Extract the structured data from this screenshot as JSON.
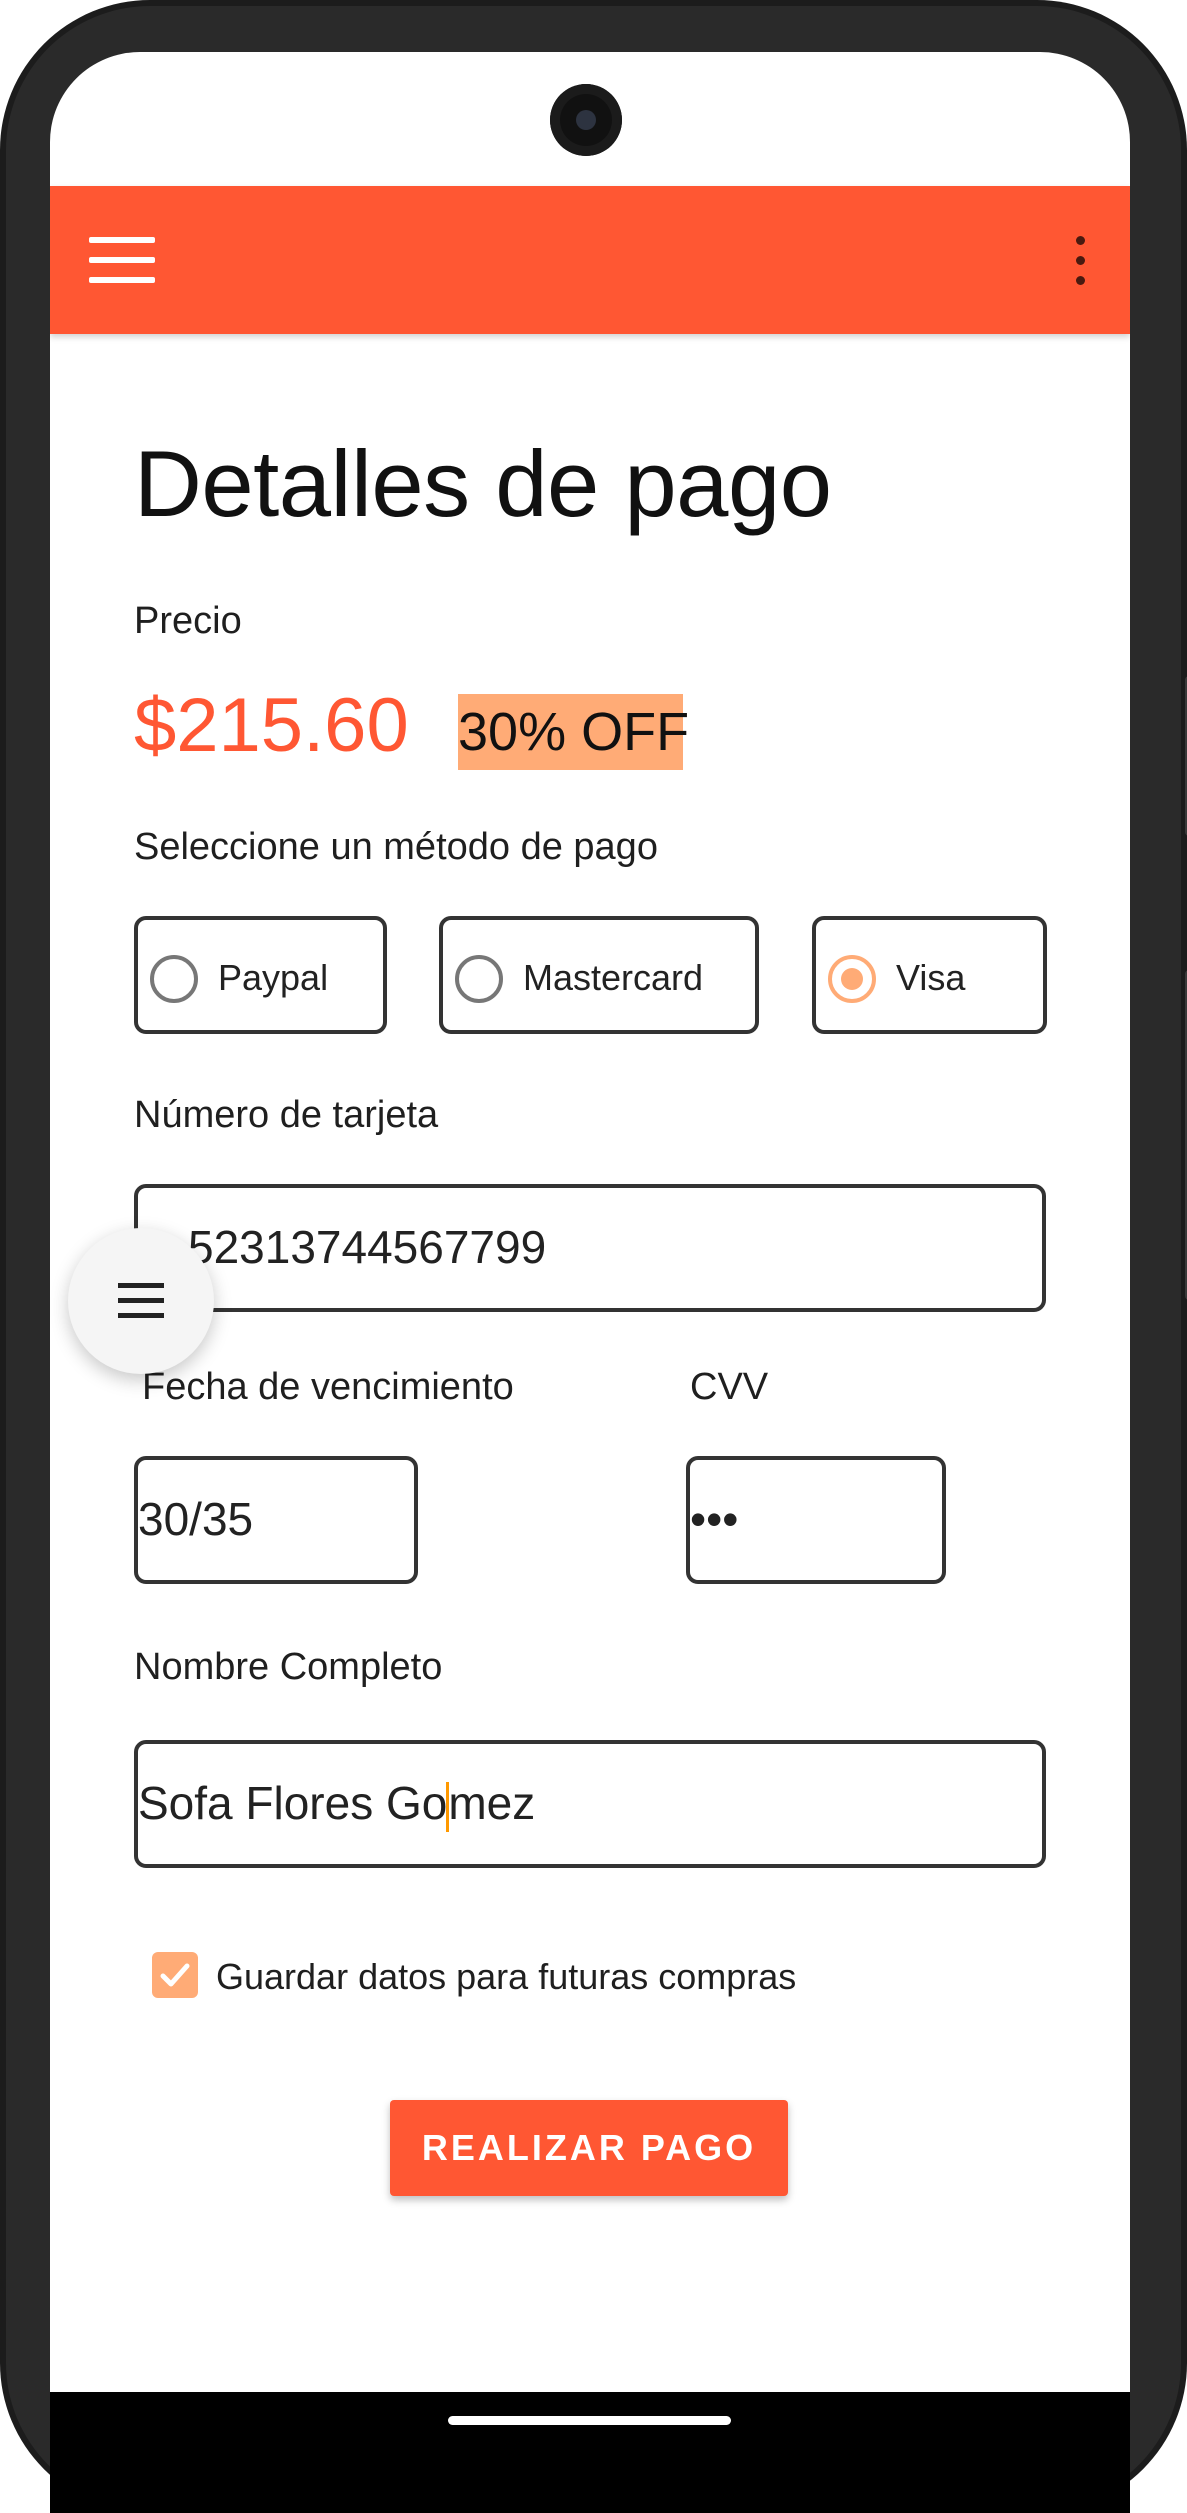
{
  "app": {
    "menu_icon": "hamburger-icon",
    "overflow_icon": "more-vert-icon",
    "accent_color": "#FF5733",
    "highlight_color": "#FFAB76"
  },
  "page": {
    "title": "Detalles de pago",
    "price_label": "Precio",
    "price": "$215.60",
    "discount": "30% OFF",
    "method_label": "Seleccione un método de pago"
  },
  "payment_methods": [
    {
      "label": "Paypal",
      "selected": false
    },
    {
      "label": "Mastercard",
      "selected": false
    },
    {
      "label": "Visa",
      "selected": true
    }
  ],
  "card": {
    "number_label": "Número de tarjeta",
    "number_value": "52313744567799",
    "expiry_label": "Fecha de vencimiento",
    "expiry_value": "30/35",
    "cvv_label": "CVV",
    "cvv_value": "•••"
  },
  "name": {
    "label": "Nombre Completo",
    "value_before_cursor": "Sofa Flores Go",
    "value_after_cursor": "mez"
  },
  "save_data": {
    "label": "Guardar datos para futuras compras",
    "checked": true
  },
  "submit_label": "REALIZAR PAGO",
  "fab_icon": "menu-icon"
}
